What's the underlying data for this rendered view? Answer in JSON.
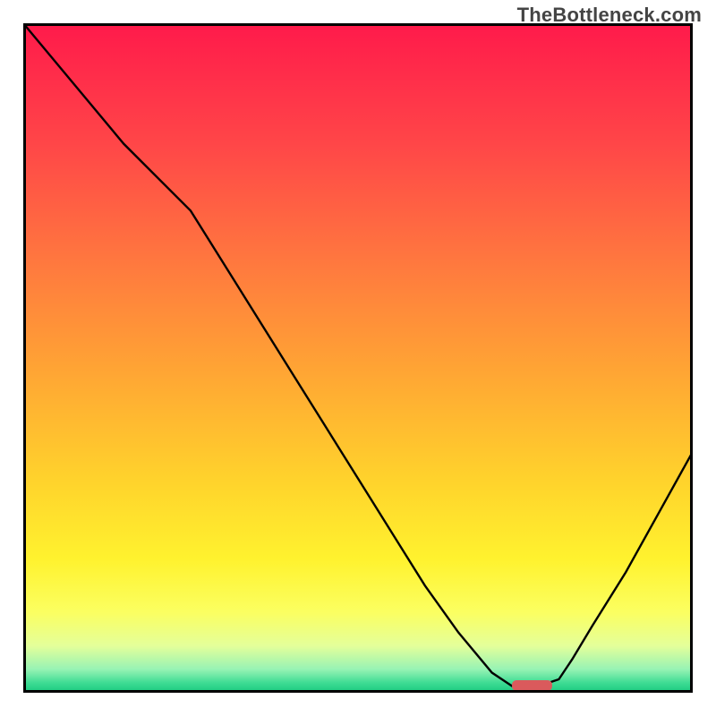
{
  "watermark": "TheBottleneck.com",
  "chart_data": {
    "type": "line",
    "title": "",
    "xlabel": "",
    "ylabel": "",
    "xlim": [
      0,
      100
    ],
    "ylim": [
      0,
      100
    ],
    "grid": false,
    "series": [
      {
        "name": "bottleneck-curve",
        "x": [
          0,
          5,
          10,
          15,
          20,
          25,
          30,
          35,
          40,
          45,
          50,
          55,
          60,
          65,
          70,
          73,
          77,
          80,
          82,
          85,
          90,
          95,
          100
        ],
        "values": [
          100,
          94,
          88,
          82,
          77,
          72,
          64,
          56,
          48,
          40,
          32,
          24,
          16,
          9,
          3,
          1,
          1,
          2,
          5,
          10,
          18,
          27,
          36
        ]
      }
    ],
    "annotations": [
      {
        "name": "optimal-marker",
        "x": 73,
        "width": 6,
        "y": 0.2,
        "color": "#da5a5c"
      }
    ],
    "background_gradient": {
      "direction": "vertical",
      "stops": [
        {
          "offset": 0.0,
          "color": "#ff1a4b"
        },
        {
          "offset": 0.18,
          "color": "#ff4648"
        },
        {
          "offset": 0.35,
          "color": "#ff763f"
        },
        {
          "offset": 0.52,
          "color": "#ffa534"
        },
        {
          "offset": 0.68,
          "color": "#ffd22c"
        },
        {
          "offset": 0.8,
          "color": "#fff22e"
        },
        {
          "offset": 0.88,
          "color": "#fbff61"
        },
        {
          "offset": 0.93,
          "color": "#e4ff9a"
        },
        {
          "offset": 0.965,
          "color": "#97f3b4"
        },
        {
          "offset": 0.985,
          "color": "#3fdc94"
        },
        {
          "offset": 1.0,
          "color": "#18c97e"
        }
      ]
    },
    "curve_style": {
      "stroke": "#000000",
      "width": 2.4
    }
  }
}
